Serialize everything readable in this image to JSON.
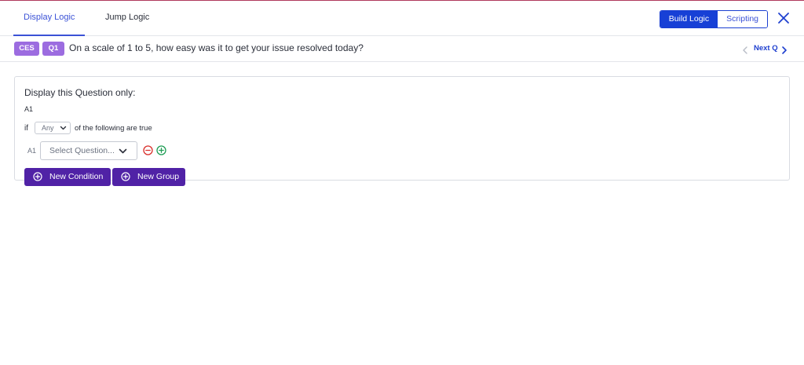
{
  "header": {
    "tabs": [
      {
        "label": "Display Logic",
        "active": true
      },
      {
        "label": "Jump Logic",
        "active": false
      }
    ],
    "mode_toggle": {
      "build_label": "Build Logic",
      "scripting_label": "Scripting",
      "selected": "Build Logic"
    },
    "close_icon": "close-icon"
  },
  "question_bar": {
    "badges": [
      "CES",
      "Q1"
    ],
    "question_text": "On a scale of 1 to 5, how easy was it to get your issue resolved today?",
    "next_label": "Next Q"
  },
  "panel": {
    "title": "Display this Question only:",
    "group_label": "A1",
    "if_label": "if",
    "match_select": "Any",
    "following_label": "of the following are true",
    "conditions": [
      {
        "label": "A1",
        "placeholder": "Select Question..."
      }
    ],
    "buttons": {
      "new_condition": "New Condition",
      "new_group": "New Group"
    }
  },
  "colors": {
    "accent_blue": "#1740d6",
    "badge_purple": "#9c6ce0",
    "button_purple": "#5022a6",
    "remove_red": "#d9302c",
    "add_green": "#1f9d55",
    "top_accent": "#b0395c"
  }
}
